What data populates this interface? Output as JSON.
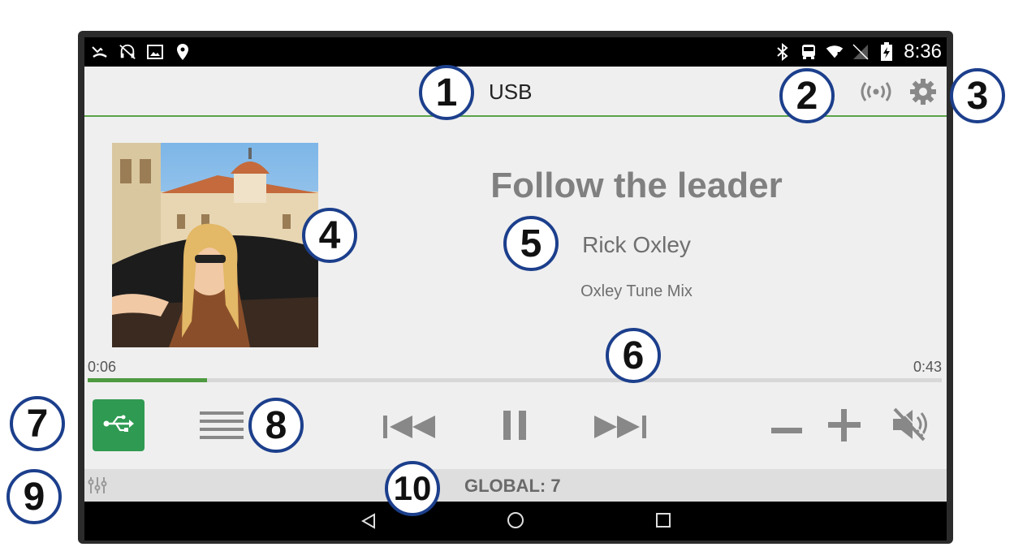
{
  "status_bar": {
    "time": "8:36",
    "left_icons": [
      "missed-call-icon",
      "no-headset-icon",
      "image-icon",
      "location-pin-icon"
    ],
    "right_icons": [
      "bluetooth-icon",
      "bus-icon",
      "wifi-alert-icon",
      "no-sim-icon",
      "battery-charging-icon"
    ]
  },
  "header": {
    "source_title": "USB",
    "broadcast_icon": "broadcast-icon",
    "settings_icon": "gear-icon",
    "accent_color": "#5aa34a"
  },
  "now_playing": {
    "title": "Follow the leader",
    "artist": "Rick Oxley",
    "album": "Oxley Tune Mix",
    "elapsed": "0:06",
    "duration": "0:43",
    "progress_fraction": 0.14
  },
  "controls": {
    "source_icon": "usb-icon",
    "source_color": "#2f9a52",
    "menu_icon": "menu-icon",
    "prev_icon": "skip-previous-icon",
    "pause_icon": "pause-icon",
    "next_icon": "skip-next-icon",
    "vol_down_icon": "minus-icon",
    "vol_up_icon": "plus-icon",
    "mute_icon": "mute-icon"
  },
  "zone_bar": {
    "eq_icon": "equalizer-icon",
    "label": "GLOBAL: 7"
  },
  "nav_bar": {
    "back_icon": "nav-back-icon",
    "home_icon": "nav-home-icon",
    "recent_icon": "nav-recent-icon"
  },
  "callouts": {
    "c1": "1",
    "c2": "2",
    "c3": "3",
    "c4": "4",
    "c5": "5",
    "c6": "6",
    "c7": "7",
    "c8": "8",
    "c9": "9",
    "c10": "10"
  }
}
